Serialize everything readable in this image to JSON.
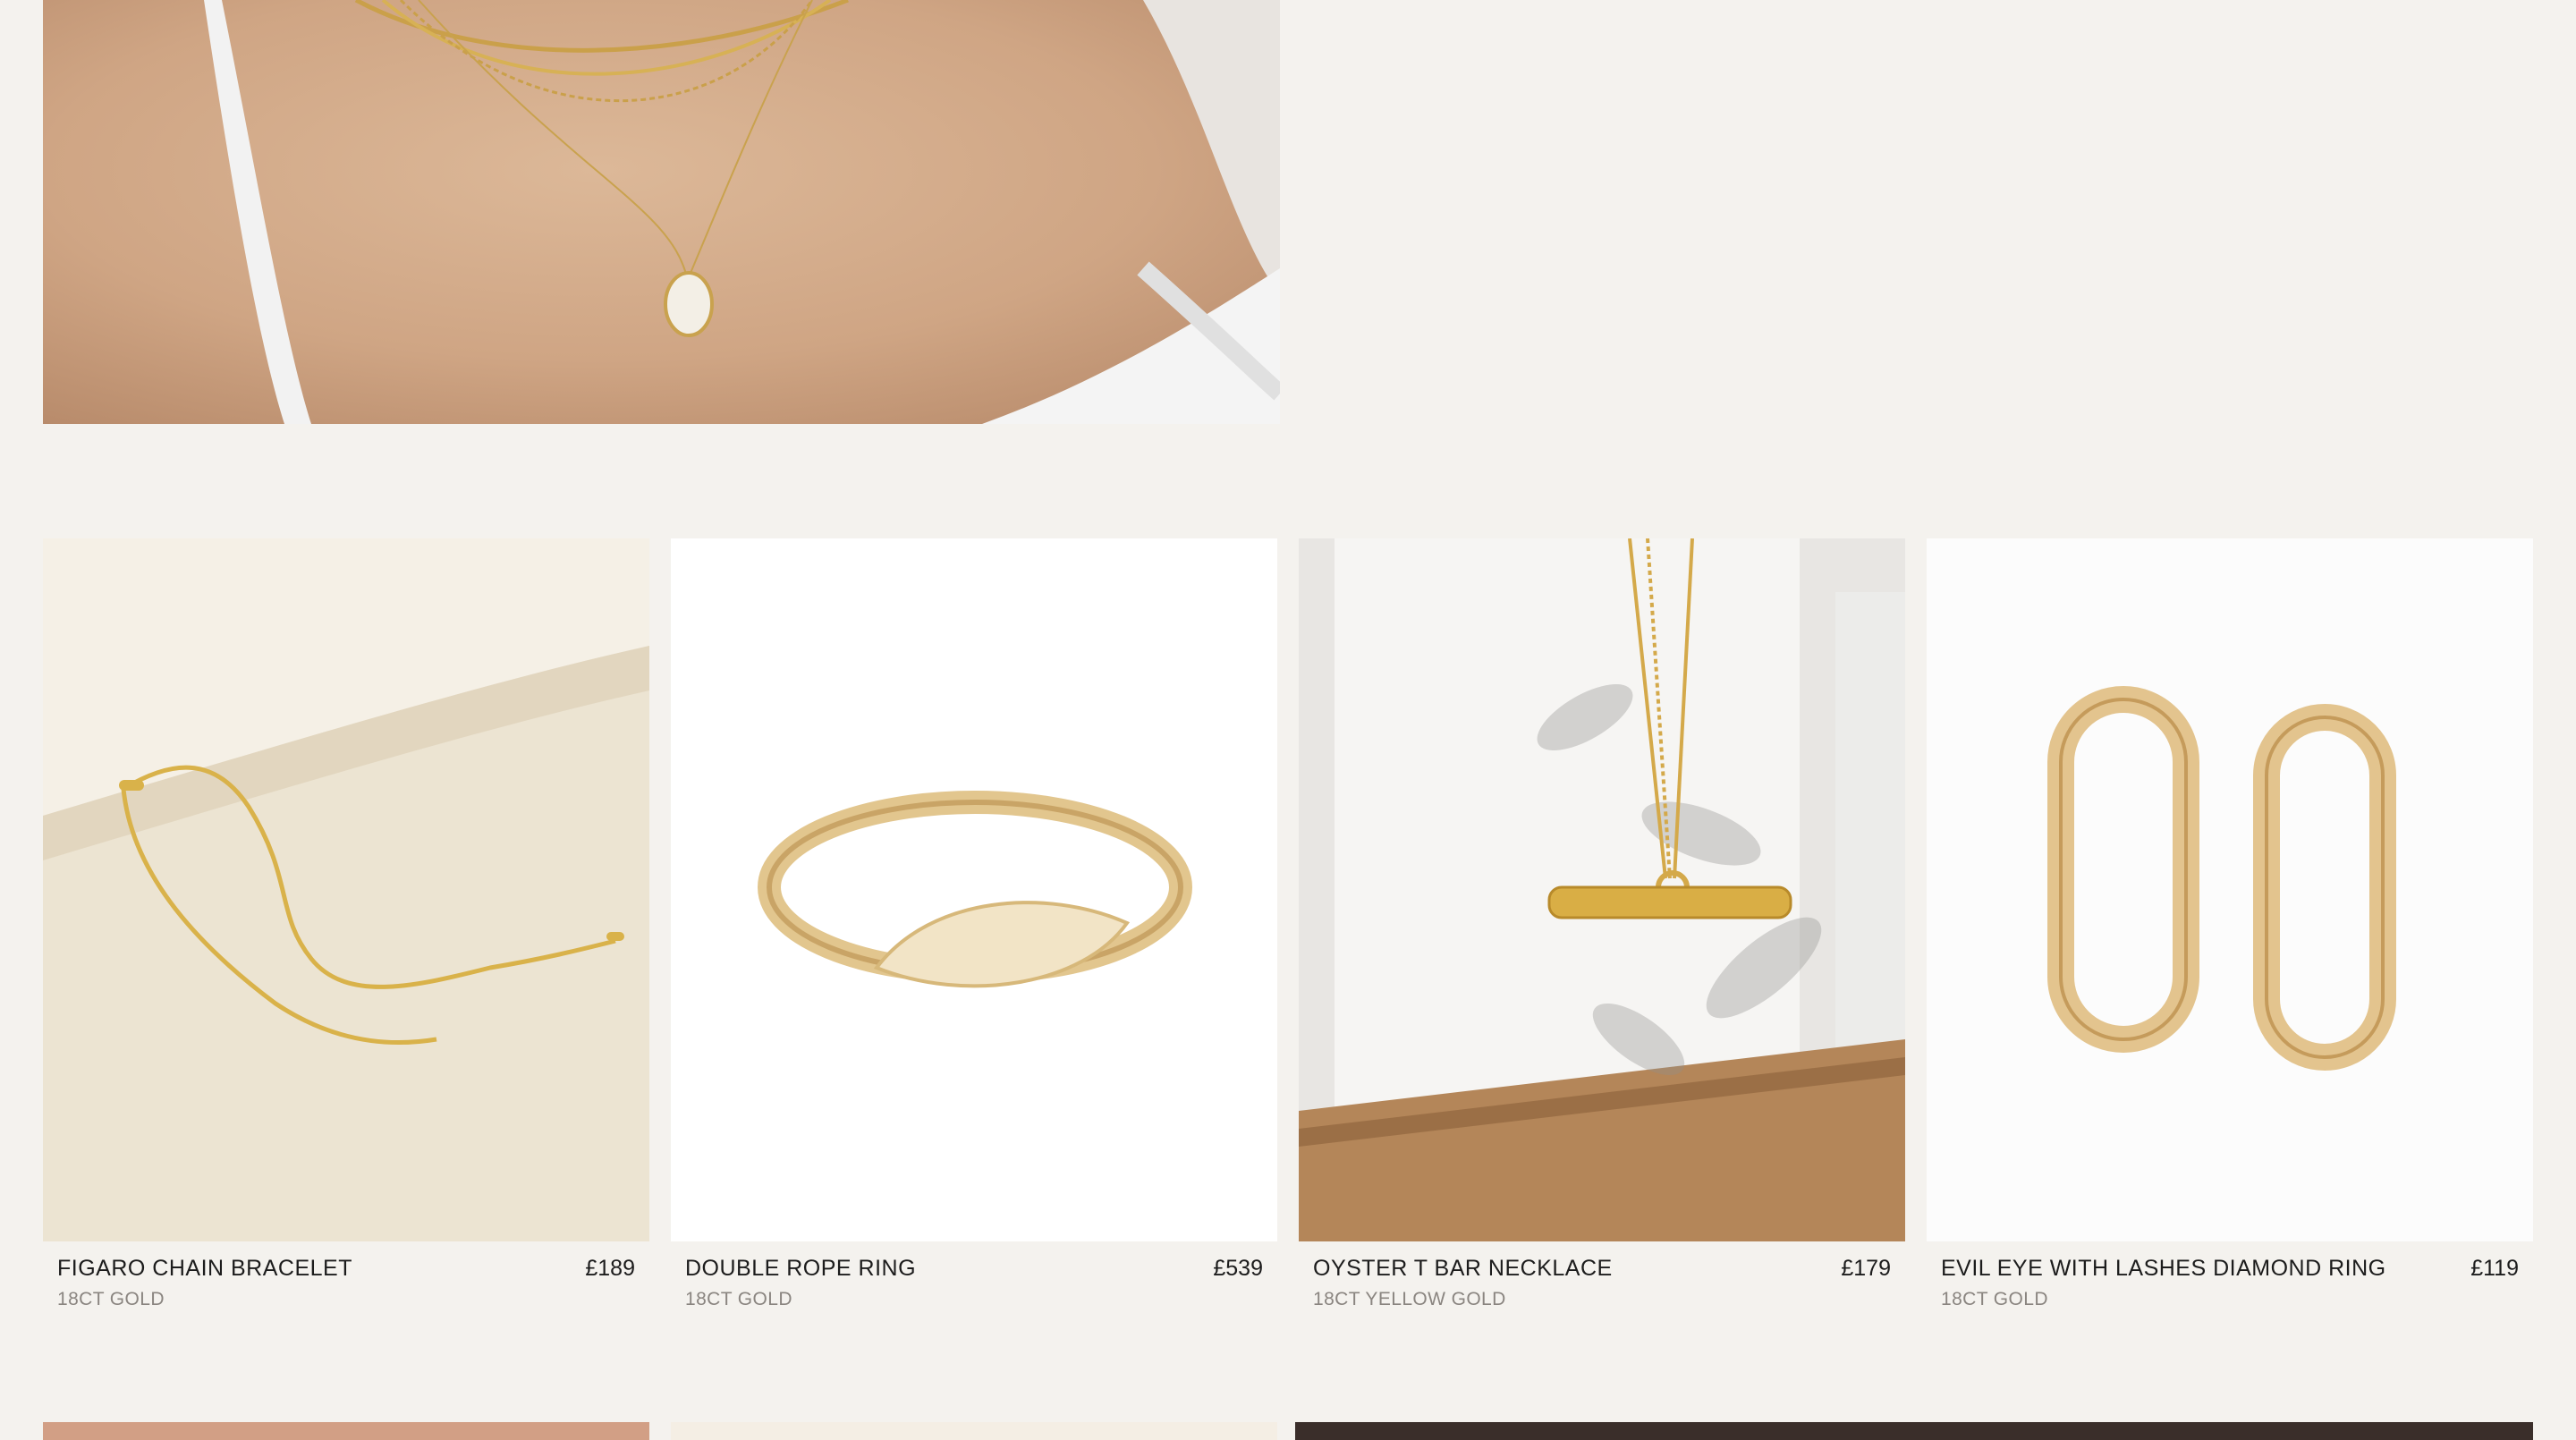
{
  "hero": {
    "image_alt": "Model wearing layered gold necklaces with pearl pendant"
  },
  "products": [
    {
      "name": "FIGARO CHAIN BRACELET",
      "price": "£189",
      "material": "18CT GOLD",
      "icon": "chain-bracelet"
    },
    {
      "name": "DOUBLE ROPE RING",
      "price": "£539",
      "material": "18CT GOLD",
      "icon": "signet-ring"
    },
    {
      "name": "OYSTER T BAR NECKLACE",
      "price": "£179",
      "material": "18CT YELLOW GOLD",
      "icon": "t-bar-necklace"
    },
    {
      "name": "EVIL EYE WITH LASHES DIAMOND RING",
      "price": "£119",
      "material": "18CT GOLD",
      "icon": "hoop-earrings"
    }
  ],
  "colors": {
    "background": "#f4f2ee",
    "text": "#1c1c1c",
    "muted": "#8a8580",
    "gold": "#d4a94a"
  }
}
